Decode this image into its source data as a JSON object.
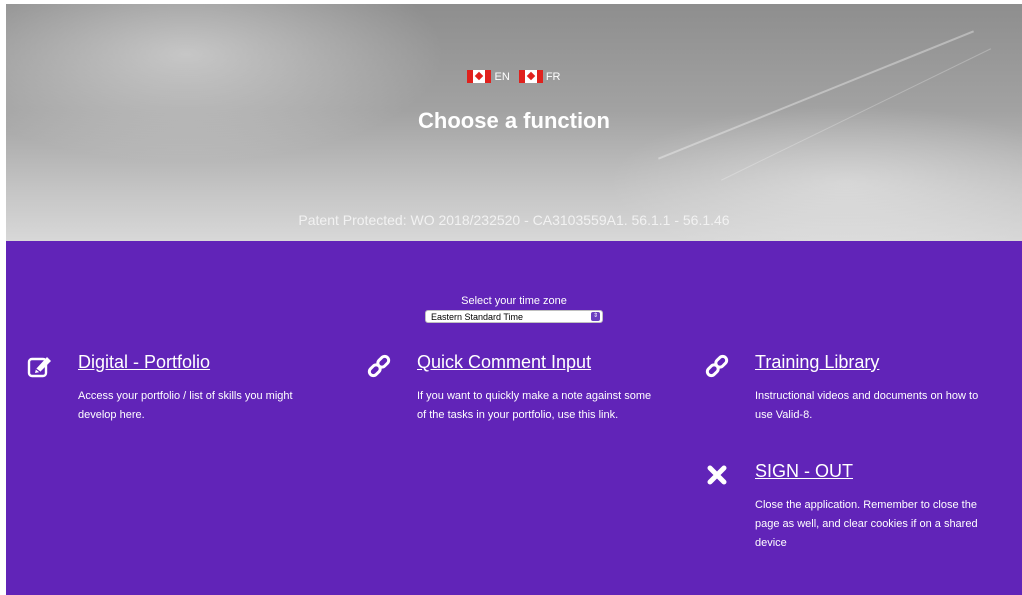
{
  "header": {
    "languages": [
      {
        "label": "EN",
        "icon": "canada-flag-icon"
      },
      {
        "label": "FR",
        "icon": "canada-flag-icon"
      }
    ],
    "title": "Choose a function",
    "patent": "Patent Protected: WO 2018/232520 - CA3103559A1. 56.1.1 - 56.1.46"
  },
  "timezone": {
    "label": "Select your time zone",
    "selected": "Eastern Standard Time"
  },
  "functions": [
    {
      "title": "Digital - Portfolio",
      "icon": "edit-icon",
      "description": "Access your portfolio / list of skills you might develop here."
    },
    {
      "title": "Quick Comment Input",
      "icon": "link-icon",
      "description": "If you want to quickly make a note against some of the tasks in your portfolio, use this link."
    },
    {
      "title": "Training Library",
      "icon": "link-icon",
      "description": "Instructional videos and documents on how to use Valid-8."
    },
    {
      "title": "SIGN - OUT",
      "icon": "close-icon",
      "description": "Close the application. Remember to close the page as well, and clear cookies if on a shared device"
    }
  ],
  "colors": {
    "accent": "#6124b8",
    "text": "#ffffff"
  }
}
